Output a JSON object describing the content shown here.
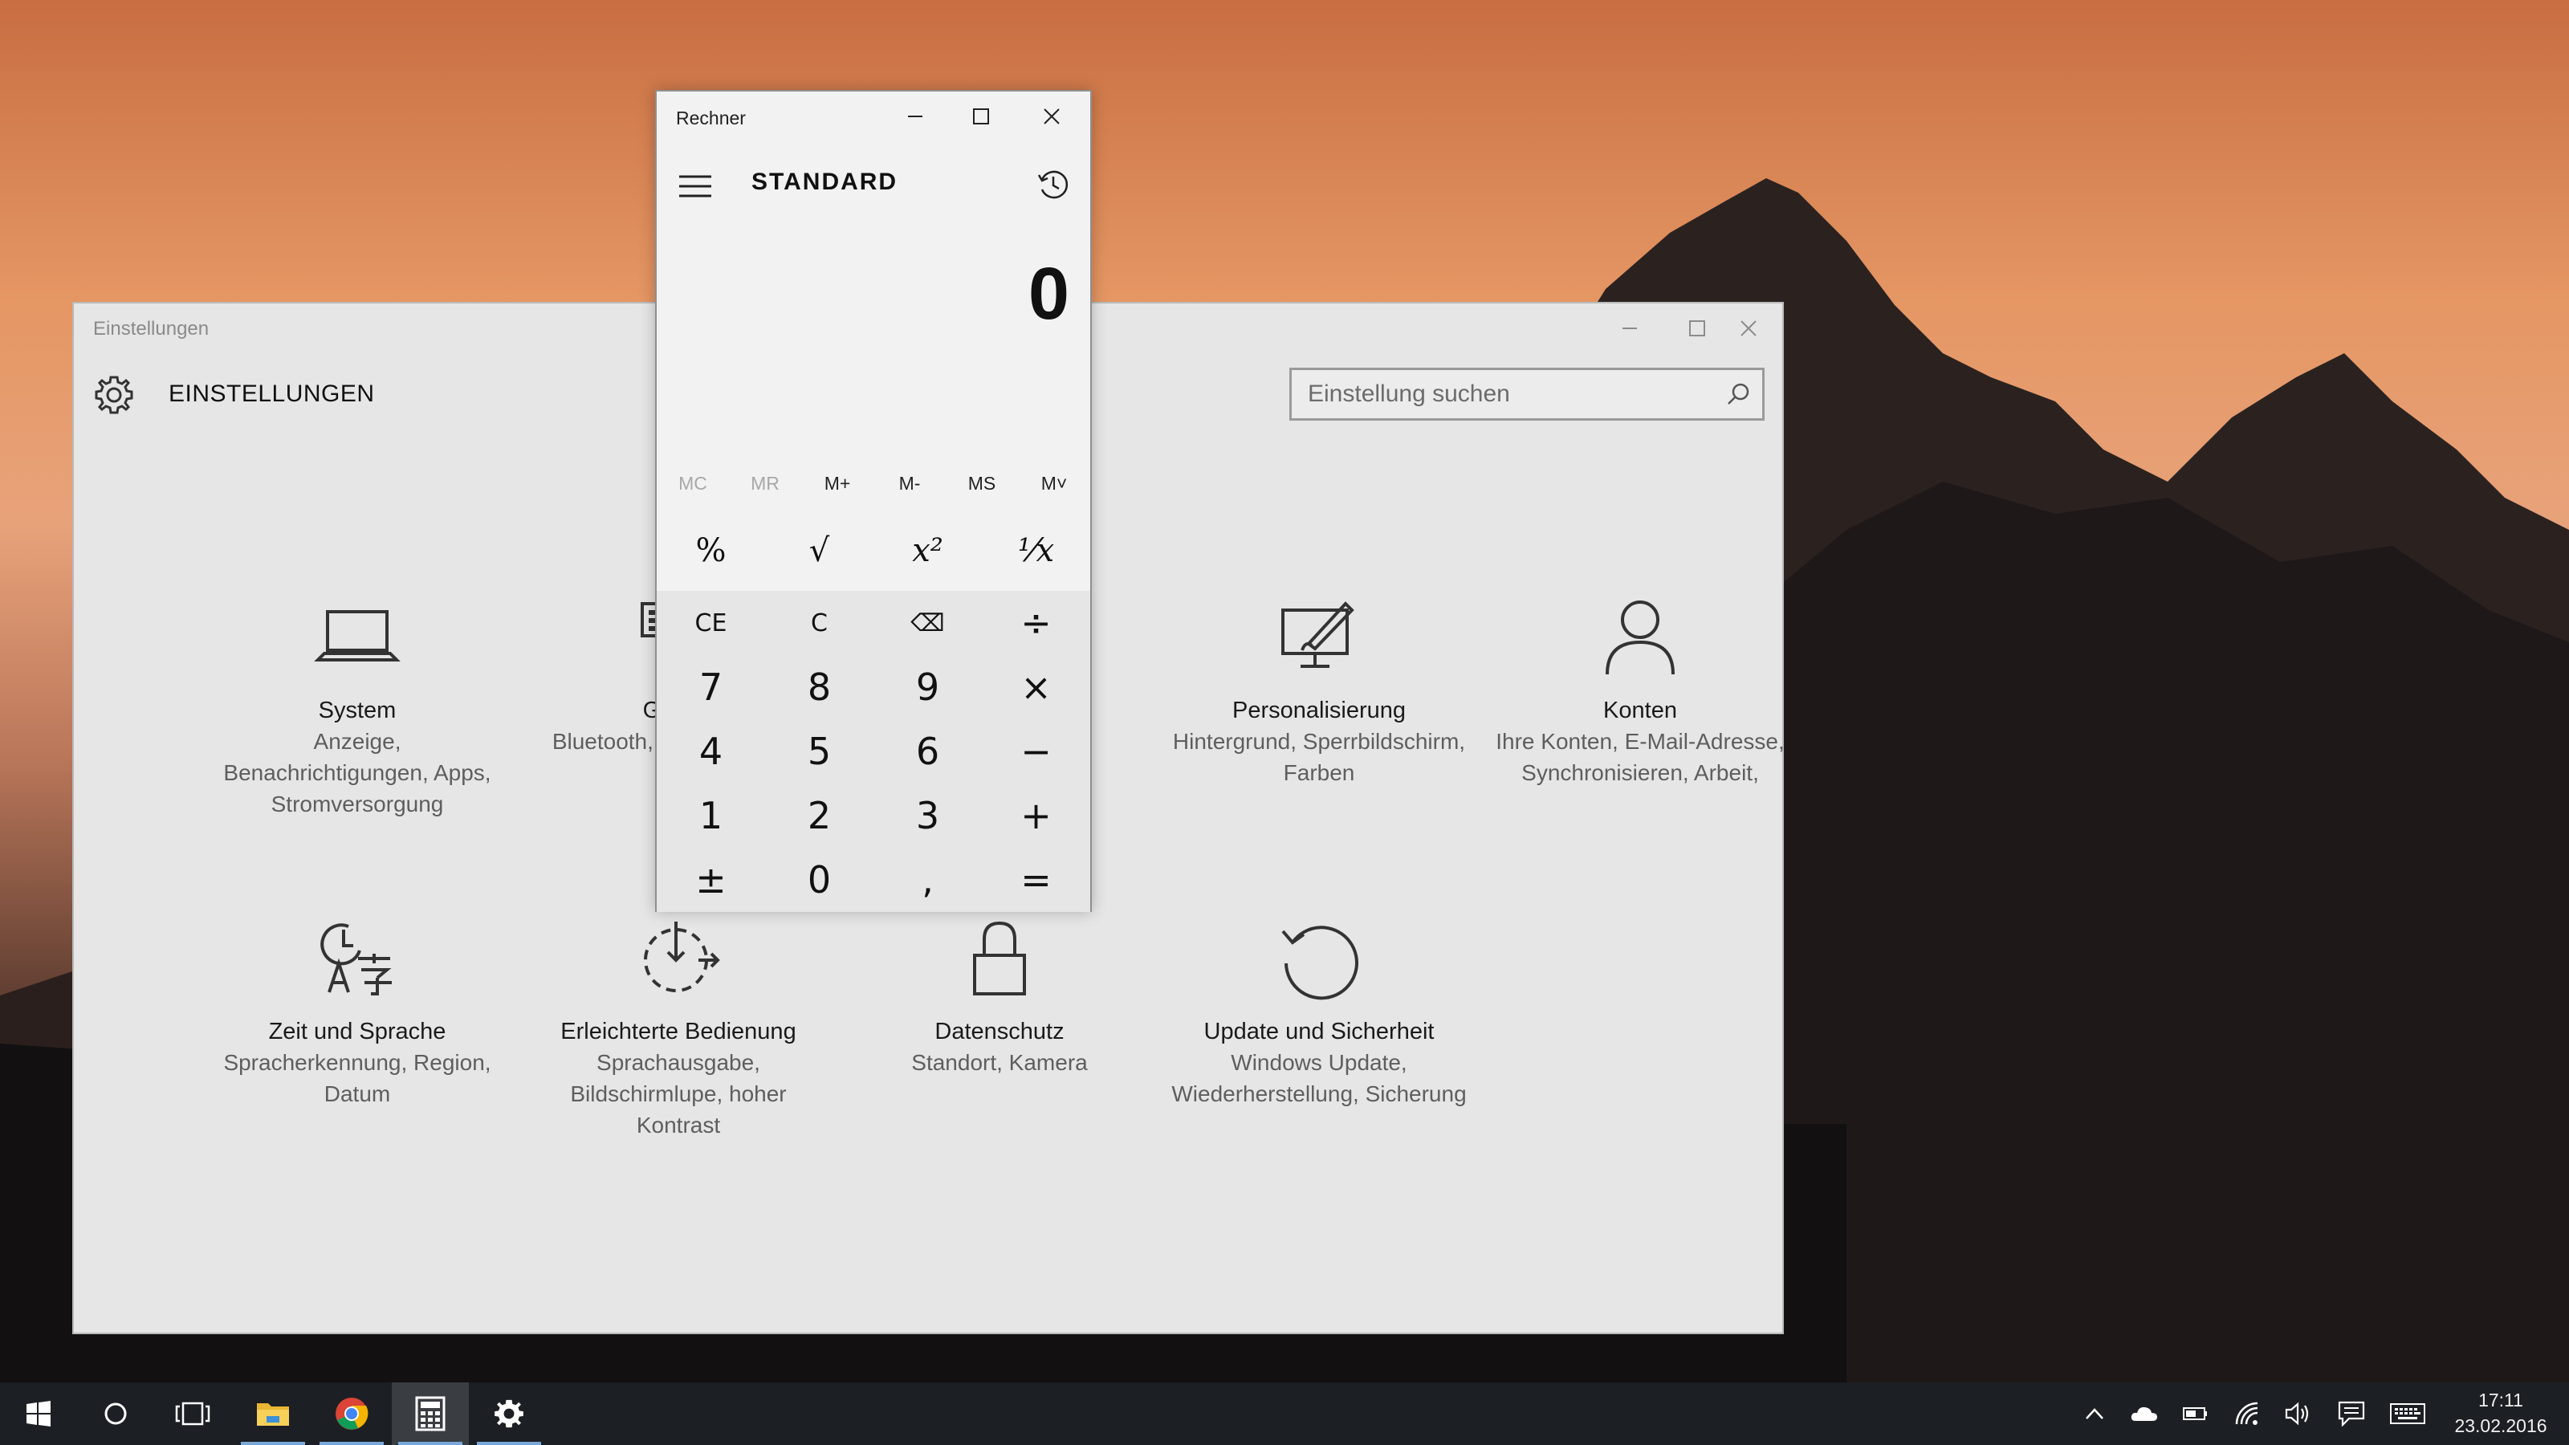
{
  "settings": {
    "window_title": "Einstellungen",
    "heading": "EINSTELLUNGEN",
    "search_placeholder": "Einstellung suchen",
    "tiles": [
      {
        "title": "System",
        "desc": "Anzeige, Benachrichtigungen, Apps, Stromversorgung",
        "icon": "laptop-icon"
      },
      {
        "title": "Geräte",
        "desc": "Bluetooth, Drucker, Maus",
        "icon": "devices-icon"
      },
      {
        "title": "Personalisierung",
        "desc": "Hintergrund, Sperrbildschirm, Farben",
        "icon": "personalization-icon"
      },
      {
        "title": "Konten",
        "desc": "Ihre Konten, E-Mail-Adresse, Synchronisieren, Arbeit,",
        "icon": "user-icon"
      },
      {
        "title": "Zeit und Sprache",
        "desc": "Spracherkennung, Region, Datum",
        "icon": "time-language-icon"
      },
      {
        "title": "Erleichterte Bedienung",
        "desc": "Sprachausgabe, Bildschirmlupe, hoher Kontrast",
        "icon": "accessibility-icon"
      },
      {
        "title": "Datenschutz",
        "desc": "Standort, Kamera",
        "icon": "lock-icon"
      },
      {
        "title": "Update und Sicherheit",
        "desc": "Windows Update, Wiederherstellung, Sicherung",
        "icon": "update-icon"
      }
    ]
  },
  "calculator": {
    "window_title": "Rechner",
    "mode": "STANDARD",
    "display": "0",
    "memory": [
      "MC",
      "MR",
      "M+",
      "M-",
      "MS",
      "M˅"
    ],
    "scientific": [
      "%",
      "√",
      "x²",
      "¹⁄x"
    ],
    "keys": [
      "CE",
      "C",
      "⌫",
      "÷",
      "7",
      "8",
      "9",
      "×",
      "4",
      "5",
      "6",
      "−",
      "1",
      "2",
      "3",
      "+",
      "±",
      "0",
      ",",
      "="
    ]
  },
  "taskbar": {
    "apps": [
      "start-icon",
      "cortana-icon",
      "task-view-icon",
      "file-explorer-icon",
      "chrome-icon",
      "calculator-icon",
      "settings-icon"
    ],
    "time": "17:11",
    "date": "23.02.2016"
  }
}
